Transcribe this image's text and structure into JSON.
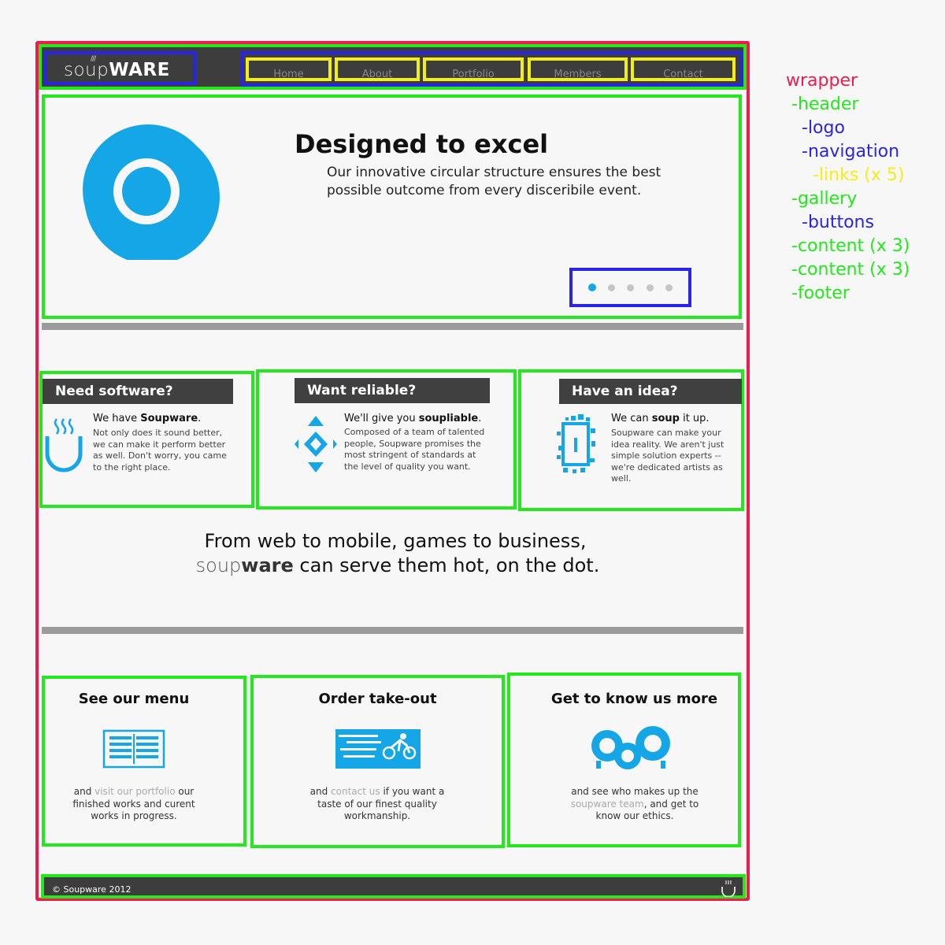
{
  "header": {
    "logo_part1": "soup",
    "logo_part2": "WARE",
    "logo_ticks": "///",
    "nav": [
      "Home",
      "About",
      "Portfolio",
      "Members",
      "Contact"
    ]
  },
  "gallery": {
    "title": "Designed to excel",
    "text": "Our innovative circular structure ensures the best possible outcome from every disceribile event.",
    "slides_total": 5,
    "active_slide": 1
  },
  "features": [
    {
      "tab": "Need software?",
      "lead_prefix": "We have ",
      "lead_bold": "Soupware",
      "lead_suffix": ".",
      "body": "Not only does it sound better, we can make it perform better as well. Don't worry, you came to the right place."
    },
    {
      "tab": "Want reliable?",
      "lead_prefix": "We'll give you ",
      "lead_bold": "soupliable",
      "lead_suffix": ".",
      "body": "Composed of a team of talented people, Soupware promises the most stringent of standards at the level of quality you want."
    },
    {
      "tab": "Have an idea?",
      "lead_prefix": "We can ",
      "lead_bold": "soup",
      "lead_suffix": " it up.",
      "body": "Soupware can make your idea reality. We aren't just simple solution experts -- we're dedicated artists as well."
    }
  ],
  "tagline": {
    "line1": "From web to mobile, games to business,",
    "soup": "soup",
    "ware": "ware",
    "line2_rest": " can serve them hot, on the dot."
  },
  "bottom": [
    {
      "title": "See our menu",
      "pre": "and ",
      "link": "visit our portfolio",
      "post": " our finished works and curent works in progress."
    },
    {
      "title": "Order take-out",
      "pre": "and ",
      "link": "contact us",
      "post": " if you want a taste of our finest quality workmanship."
    },
    {
      "title": "Get to know us more",
      "pre": "and see who makes up the ",
      "link": "soupware team",
      "post": ", and get to know our ethics."
    }
  ],
  "footer": {
    "copyright": "© Soupware 2012"
  },
  "legend": [
    {
      "label": "wrapper",
      "color": "#ef1a4e"
    },
    {
      "label": "-header",
      "color": "#22e81c"
    },
    {
      "label": "-logo",
      "color": "#2a24e4"
    },
    {
      "label": "-navigation",
      "color": "#2a24e4"
    },
    {
      "label": "-links (x 5)",
      "color": "#f4ee17"
    },
    {
      "label": "-gallery",
      "color": "#22e81c"
    },
    {
      "label": "-buttons",
      "color": "#2a24e4"
    },
    {
      "label": "-content (x 3)",
      "color": "#22e81c"
    },
    {
      "label": "-content (x 3)",
      "color": "#22e81c"
    },
    {
      "label": "-footer",
      "color": "#22e81c"
    }
  ]
}
